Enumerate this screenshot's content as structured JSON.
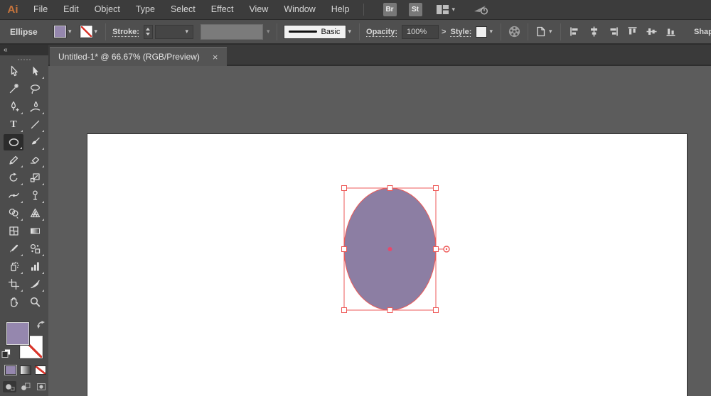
{
  "colors": {
    "purple": "#9587AE",
    "ellipse": "#8C7EA3",
    "sel": "#EE5A58",
    "nonered": "#D9352B"
  },
  "menu_bar": {
    "logo": "Ai",
    "items": [
      "File",
      "Edit",
      "Object",
      "Type",
      "Select",
      "Effect",
      "View",
      "Window",
      "Help"
    ],
    "bridge_label": "Br",
    "stock_label": "St"
  },
  "control_bar": {
    "context_label": "Ellipse",
    "stroke_label": "Stroke:",
    "brush_name": "Basic",
    "opacity_label": "Opacity:",
    "opacity_value": "100%",
    "opacity_expand": ">",
    "style_label": "Style:",
    "shape_label": "Shap"
  },
  "tab_bar": {
    "active_tab": "Untitled-1* @ 66.67% (RGB/Preview)",
    "close_glyph": "×"
  },
  "toolbar": {
    "collapse_glyph": "«",
    "tools": [
      "selection",
      "direct-selection",
      "magic-wand",
      "lasso",
      "pen",
      "curvature",
      "type",
      "line-segment",
      "ellipse",
      "paintbrush",
      "pencil",
      "eraser",
      "rotate",
      "scale",
      "width",
      "puppet-warp",
      "shape-builder",
      "perspective-grid",
      "mesh",
      "gradient",
      "eyedropper",
      "blend",
      "symbol-sprayer",
      "column-graph",
      "artboard",
      "slice",
      "hand",
      "zoom"
    ],
    "selected_tool": "ellipse"
  },
  "icons": {
    "chevron_down": "▾",
    "type_glyph": "T"
  }
}
